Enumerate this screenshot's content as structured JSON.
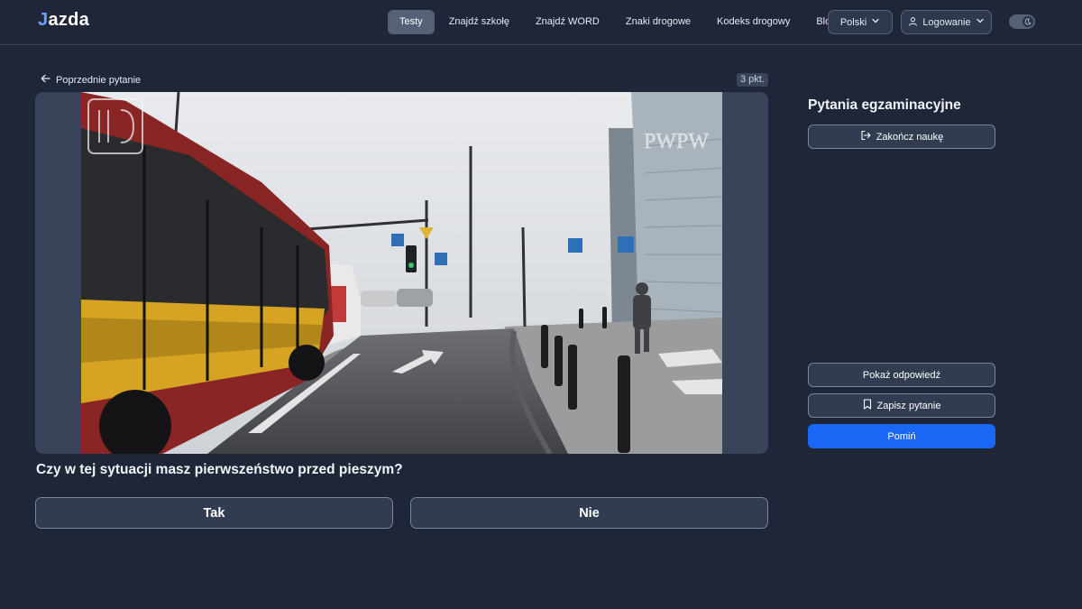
{
  "header": {
    "logo_text": "azda",
    "logo_mark": "J",
    "nav": [
      {
        "label": "Testy",
        "active": true
      },
      {
        "label": "Znajdź szkołę",
        "active": false
      },
      {
        "label": "Znajdź WORD",
        "active": false
      },
      {
        "label": "Znaki drogowe",
        "active": false
      },
      {
        "label": "Kodeks drogowy",
        "active": false
      },
      {
        "label": "Blog",
        "active": false
      }
    ],
    "language_label": "Polski",
    "login_label": "Logowanie",
    "theme_toggle_icon": "moon-icon"
  },
  "main": {
    "prev_link_label": "Poprzednie pytanie",
    "points_badge": "3 pkt.",
    "media_watermark_right": "PWPW",
    "question": "Czy w tej sytuacji masz pierwszeństwo przed pieszym?",
    "answers": [
      "Tak",
      "Nie"
    ]
  },
  "sidebar": {
    "title": "Pytania egzaminacyjne",
    "finish_label": "Zakończ naukę",
    "show_answer_label": "Pokaż odpowiedź",
    "save_question_label": "Zapisz pytanie",
    "skip_label": "Pomiń"
  },
  "colors": {
    "background": "#1e2638",
    "primary": "#1a66f5",
    "accent_logo": "#6d9bff"
  }
}
